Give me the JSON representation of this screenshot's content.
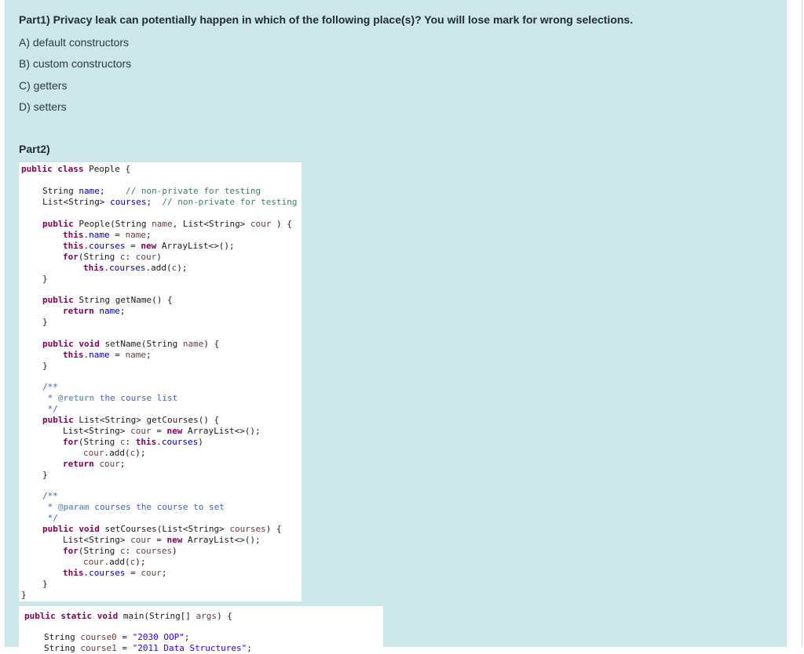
{
  "question": {
    "title": "Part1) Privacy leak can potentially happen in which of the following place(s)? You will lose mark for wrong selections.",
    "options": [
      "A) default constructors",
      "B) custom constructors",
      "C) getters",
      "D) setters"
    ]
  },
  "part2": {
    "heading": "Part2)"
  },
  "colors": {
    "panel_background": "#cde6ea",
    "keyword": "#7f0055",
    "field": "#0000c0",
    "comment": "#3f7f5f",
    "javadoc": "#3f5fbf",
    "string": "#2a00ff"
  }
}
